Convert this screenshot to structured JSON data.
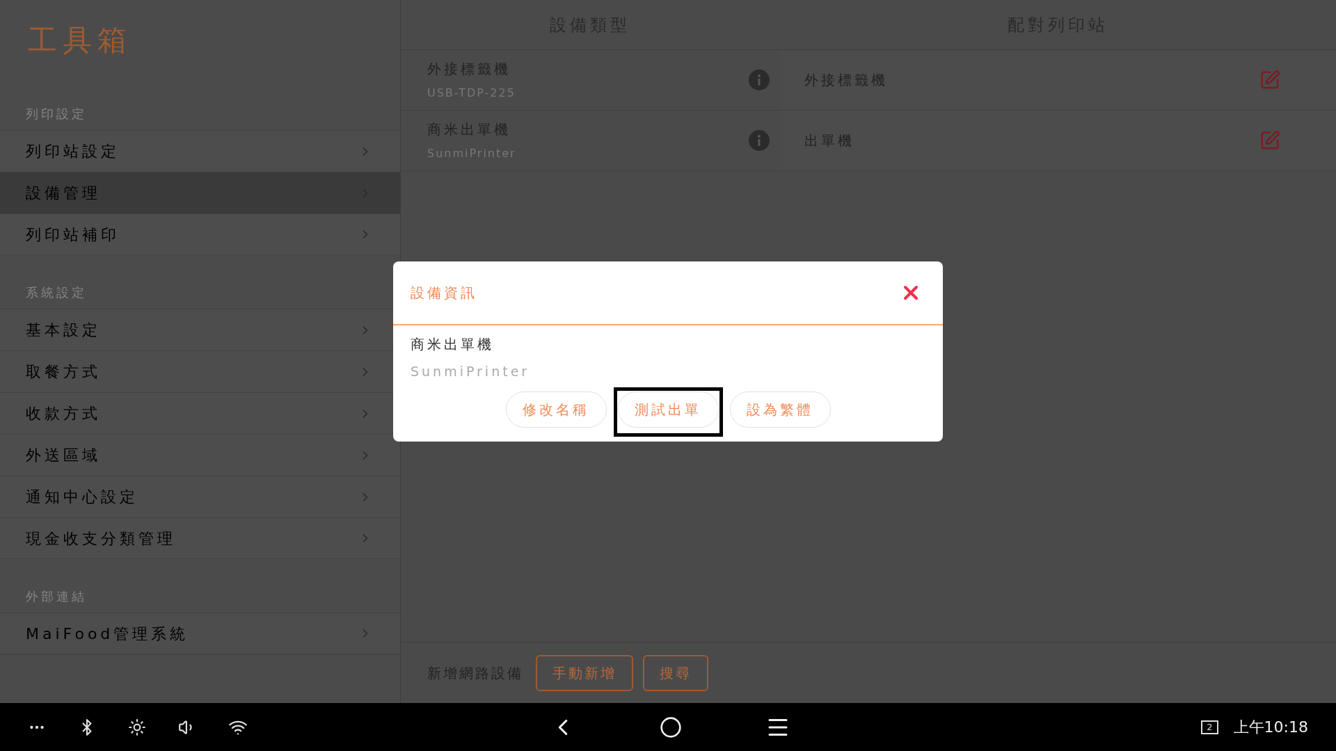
{
  "sidebar": {
    "title": "工具箱",
    "sections": [
      {
        "heading": "列印設定",
        "items": [
          {
            "label": "列印站設定",
            "selected": false
          },
          {
            "label": "設備管理",
            "selected": true
          },
          {
            "label": "列印站補印",
            "selected": false
          }
        ]
      },
      {
        "heading": "系統設定",
        "items": [
          {
            "label": "基本設定",
            "selected": false
          },
          {
            "label": "取餐方式",
            "selected": false
          },
          {
            "label": "收款方式",
            "selected": false
          },
          {
            "label": "外送區域",
            "selected": false
          },
          {
            "label": "通知中心設定",
            "selected": false
          },
          {
            "label": "現金收支分類管理",
            "selected": false
          }
        ]
      },
      {
        "heading": "外部連結",
        "items": [
          {
            "label": "MaiFood管理系統",
            "selected": false
          }
        ]
      }
    ]
  },
  "table": {
    "columns": [
      "設備類型",
      "配對列印站"
    ],
    "rows": [
      {
        "device": "外接標籤機",
        "model": "USB-TDP-225",
        "station": "外接標籤機"
      },
      {
        "device": "商米出單機",
        "model": "SunmiPrinter",
        "station": "出單機"
      }
    ]
  },
  "footer": {
    "label": "新增網路設備",
    "buttons": [
      "手動新增",
      "搜尋"
    ]
  },
  "dialog": {
    "title": "設備資訊",
    "device": "商米出單機",
    "model": "SunmiPrinter",
    "buttons": [
      {
        "label": "修改名稱",
        "highlighted": false
      },
      {
        "label": "測試出單",
        "highlighted": true
      },
      {
        "label": "設為繁體",
        "highlighted": false
      }
    ]
  },
  "status_bar": {
    "screen_badge": "2",
    "time": "上午10:18"
  }
}
